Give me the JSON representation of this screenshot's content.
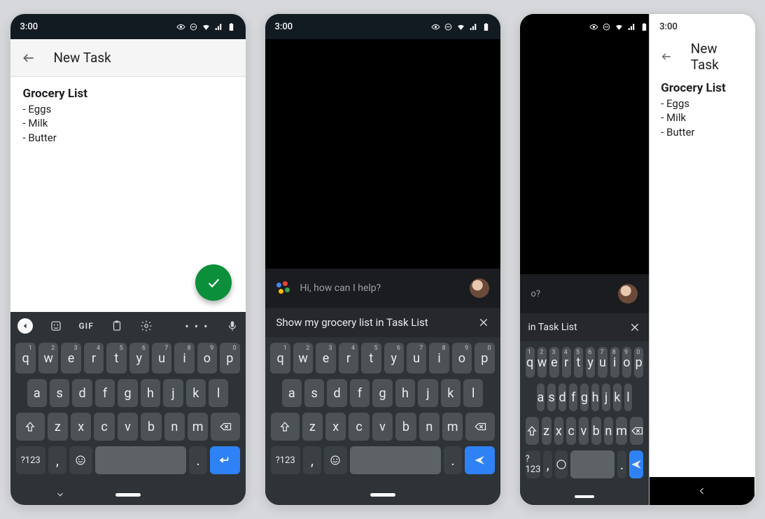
{
  "status": {
    "time": "3:00"
  },
  "panel1": {
    "app_title": "New Task",
    "note_title": "Grocery List",
    "items": [
      "- Eggs",
      "- Milk",
      "- Butter"
    ]
  },
  "panel2": {
    "assist_prompt": "Hi, how can I help?",
    "typed": "Show my grocery list in Task List"
  },
  "panel3": {
    "typed_tail": "in Task List",
    "assist_tail": "o?",
    "app_title": "New Task",
    "note_title": "Grocery List",
    "items": [
      "- Eggs",
      "- Milk",
      "- Butter"
    ]
  },
  "kb_toolbar": {
    "gif_label": "GIF",
    "more": "• • •"
  },
  "keyboard": {
    "row1": [
      [
        "q",
        "1"
      ],
      [
        "w",
        "2"
      ],
      [
        "e",
        "3"
      ],
      [
        "r",
        "4"
      ],
      [
        "t",
        "5"
      ],
      [
        "y",
        "6"
      ],
      [
        "u",
        "7"
      ],
      [
        "i",
        "8"
      ],
      [
        "o",
        "9"
      ],
      [
        "p",
        "0"
      ]
    ],
    "row2": [
      "a",
      "s",
      "d",
      "f",
      "g",
      "h",
      "j",
      "k",
      "l"
    ],
    "row3": [
      "z",
      "x",
      "c",
      "v",
      "b",
      "n",
      "m"
    ],
    "sym": "?123",
    "comma": ",",
    "period": "."
  }
}
